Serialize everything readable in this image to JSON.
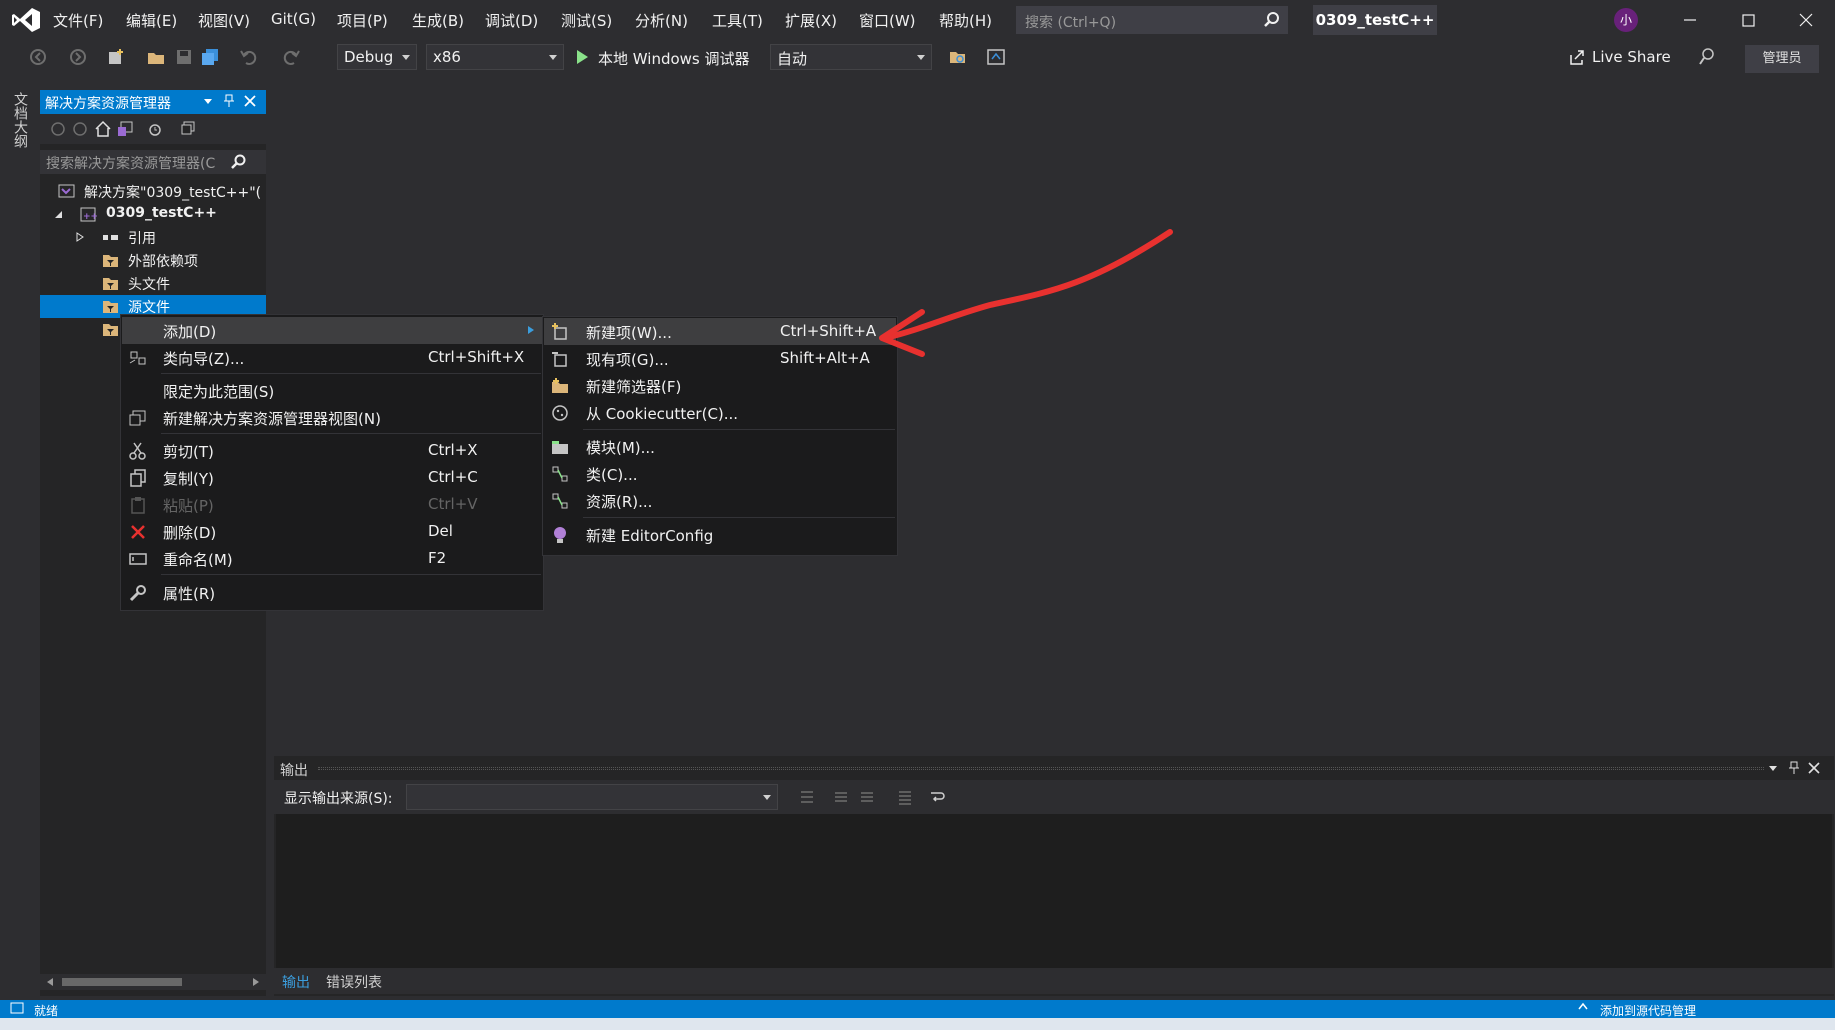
{
  "menubar": {
    "items": [
      "文件(F)",
      "编辑(E)",
      "视图(V)",
      "Git(G)",
      "项目(P)",
      "生成(B)",
      "调试(D)",
      "测试(S)",
      "分析(N)",
      "工具(T)",
      "扩展(X)",
      "窗口(W)",
      "帮助(H)"
    ],
    "search_placeholder": "搜索 (Ctrl+Q)",
    "solution_title": "0309_testC++",
    "avatar_initial": "小"
  },
  "toolbar": {
    "config": "Debug",
    "platform": "x86",
    "debugger": "本地 Windows 调试器",
    "auto": "自动",
    "live_share": "Live Share",
    "admin": "管理员"
  },
  "vertical_tab": "文档大纲",
  "solution_explorer": {
    "title": "解决方案资源管理器",
    "search_placeholder": "搜索解决方案资源管理器(C",
    "tree": [
      {
        "label": "解决方案\"0309_testC++\"(",
        "icon": "solution-icon"
      },
      {
        "label": "0309_testC++",
        "icon": "project-icon"
      },
      {
        "label": "引用",
        "icon": "references-icon"
      },
      {
        "label": "外部依赖项",
        "icon": "folder-filter-icon"
      },
      {
        "label": "头文件",
        "icon": "folder-filter-icon"
      },
      {
        "label": "源文件",
        "icon": "folder-filter-icon"
      },
      {
        "label": "",
        "icon": "folder-filter-icon"
      }
    ]
  },
  "context_menu": {
    "items": [
      {
        "label": "添加(D)",
        "shortcut": "",
        "icon": "",
        "submenu": true
      },
      {
        "label": "类向导(Z)...",
        "shortcut": "Ctrl+Shift+X",
        "icon": "class-wizard-icon"
      },
      {
        "label": "限定为此范围(S)",
        "shortcut": "",
        "icon": ""
      },
      {
        "label": "新建解决方案资源管理器视图(N)",
        "shortcut": "",
        "icon": "new-view-icon"
      },
      {
        "label": "剪切(T)",
        "shortcut": "Ctrl+X",
        "icon": "scissors-icon"
      },
      {
        "label": "复制(Y)",
        "shortcut": "Ctrl+C",
        "icon": "copy-icon"
      },
      {
        "label": "粘贴(P)",
        "shortcut": "Ctrl+V",
        "icon": "paste-icon",
        "disabled": true
      },
      {
        "label": "删除(D)",
        "shortcut": "Del",
        "icon": "delete-icon"
      },
      {
        "label": "重命名(M)",
        "shortcut": "F2",
        "icon": "rename-icon"
      },
      {
        "label": "属性(R)",
        "shortcut": "",
        "icon": "wrench-icon"
      }
    ]
  },
  "submenu": {
    "items": [
      {
        "label": "新建项(W)...",
        "shortcut": "Ctrl+Shift+A",
        "icon": "new-item-icon"
      },
      {
        "label": "现有项(G)...",
        "shortcut": "Shift+Alt+A",
        "icon": "existing-item-icon"
      },
      {
        "label": "新建筛选器(F)",
        "shortcut": "",
        "icon": "new-filter-icon"
      },
      {
        "label": "从 Cookiecutter(C)...",
        "shortcut": "",
        "icon": "cookiecutter-icon"
      },
      {
        "label": "模块(M)...",
        "shortcut": "",
        "icon": "module-icon"
      },
      {
        "label": "类(C)...",
        "shortcut": "",
        "icon": "class-icon"
      },
      {
        "label": "资源(R)...",
        "shortcut": "",
        "icon": "resource-icon"
      },
      {
        "label": "新建 EditorConfig",
        "shortcut": "",
        "icon": "editorconfig-icon"
      }
    ]
  },
  "output": {
    "title": "输出",
    "source_label": "显示输出来源(S):",
    "tabs": [
      "输出",
      "错误列表"
    ]
  },
  "statusbar": {
    "left": "就绪",
    "right": "添加到源代码管理"
  },
  "colors": {
    "accent": "#007acc",
    "annotation": "#e8312f",
    "background": "#2d2d30"
  }
}
